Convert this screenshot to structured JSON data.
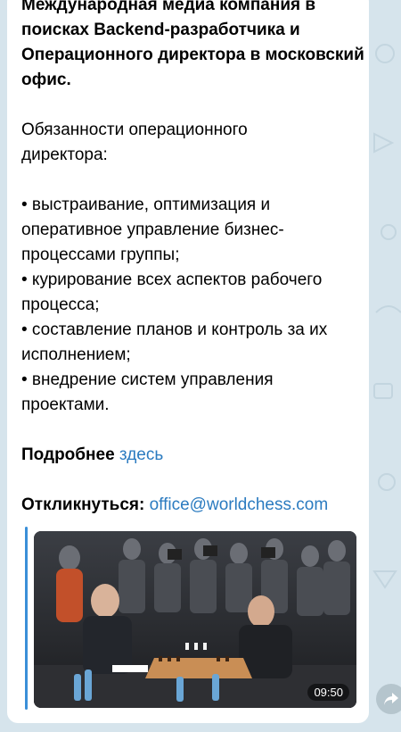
{
  "message": {
    "title": "Международная медиа компания в поисках Backend-разработчика и Операционного директора в московский офис.",
    "section_heading": "Обязанности операционного директора:",
    "bullets": [
      "• выстраивание, оптимизация и оперативное управление бизнес-процессами группы;",
      "• курирование всех аспектов рабочего процесса;",
      "• составление планов и контроль за их исполнением;",
      "• внедрение систем управления проектами."
    ],
    "more_label": "Подробнее",
    "more_link": "здесь",
    "respond_label": "Откликнуться",
    "respond_colon": ":",
    "respond_email": "office@worldchess.com"
  },
  "preview": {
    "duration": "09:50",
    "accent_color": "#3a8fd8"
  },
  "icons": {
    "share": "share-arrow-icon"
  }
}
